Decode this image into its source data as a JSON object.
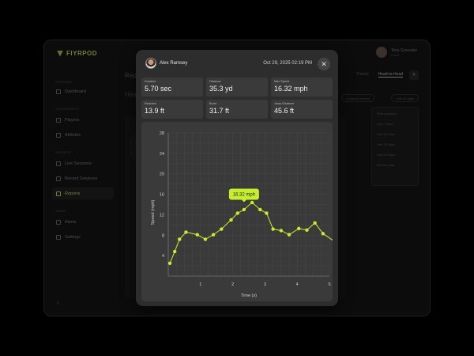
{
  "app": {
    "logo": "FIYRPOD",
    "nav_sections": [
      "Overview",
      "Assessments",
      "Reports",
      "Admin"
    ],
    "nav_items": [
      "Dashboard",
      "Players",
      "Athletes",
      "Live Sessions",
      "Recent Sessions",
      "Reports",
      "Alerts",
      "Settings"
    ],
    "active_nav": "Reports",
    "page_title": "Rep",
    "page_sub": "Hea",
    "tabs": [
      "Trends",
      "Head-to-Head"
    ],
    "selects": [
      "Compare metrics",
      "Last 30 days"
    ],
    "dropdown_items": [
      "Prior sessions",
      "Last 7 days",
      "Last 14 days",
      "Last 30 days",
      "Last 90 days",
      "All time data"
    ],
    "user": {
      "name": "Tony Gonzalez",
      "role": "Coach"
    }
  },
  "modal": {
    "athlete": "Alex Ramsey",
    "timestamp": "Oct 29, 2025 02:19 PM",
    "close_label": "✕",
    "stats": [
      {
        "label": "Duration",
        "value": "5.70 sec"
      },
      {
        "label": "Distance",
        "value": "35.3 yd"
      },
      {
        "label": "Max Speed",
        "value": "16.32 mph"
      },
      {
        "label": "Reaction",
        "value": "13.9 ft"
      },
      {
        "label": "Burst",
        "value": "31.7 ft"
      },
      {
        "label": "Jump Distance",
        "value": "45.6 ft"
      }
    ]
  },
  "chart_data": {
    "type": "line",
    "xlabel": "Time (s)",
    "ylabel": "Speed (mph)",
    "xlim": [
      0,
      5
    ],
    "ylim": [
      0,
      28
    ],
    "xticks": [
      1,
      2,
      3,
      4,
      5
    ],
    "yticks": [
      4,
      8,
      12,
      16,
      20,
      24,
      28
    ],
    "grid": true,
    "color": "#c6ee2f",
    "x": [
      0.05,
      0.2,
      0.35,
      0.55,
      0.9,
      1.15,
      1.4,
      1.65,
      1.95,
      2.15,
      2.35,
      2.6,
      2.85,
      3.05,
      3.25,
      3.5,
      3.75,
      4.05,
      4.3,
      4.55,
      4.8,
      5.2
    ],
    "values": [
      2.5,
      4.8,
      7.2,
      8.6,
      8.1,
      7.2,
      8.1,
      9.2,
      11.0,
      12.3,
      13.0,
      14.4,
      13.0,
      12.3,
      9.2,
      8.9,
      8.1,
      9.3,
      9.0,
      10.4,
      8.3,
      6.6
    ],
    "highlight": {
      "x": 2.35,
      "y": 16.32,
      "label": "16.32 mph"
    }
  }
}
